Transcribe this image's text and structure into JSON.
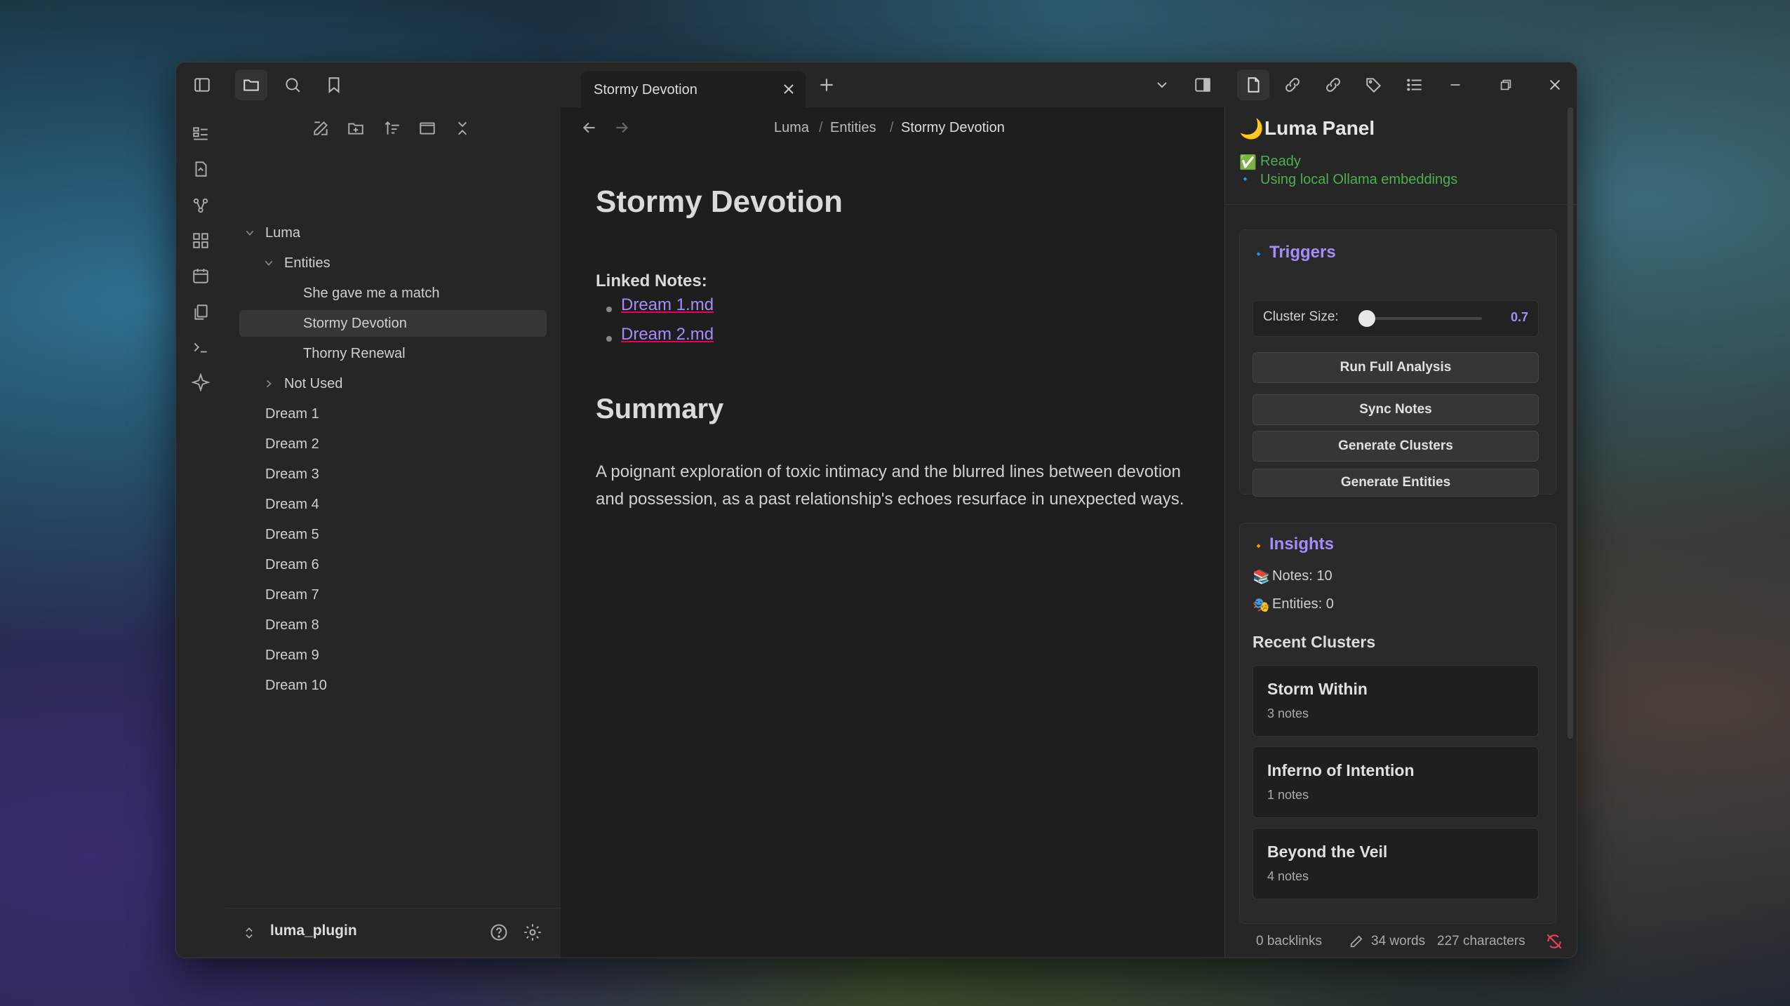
{
  "tabs": [
    {
      "title": "Stormy Devotion"
    }
  ],
  "breadcrumb": [
    "Luma",
    "Entities",
    "Stormy Devotion"
  ],
  "breadcrumb_sep": "/",
  "file_tree": {
    "root": "Luma",
    "entities_folder": "Entities",
    "entities": [
      "She gave me a match",
      "Stormy Devotion",
      "Thorny Renewal"
    ],
    "not_used_folder": "Not Used",
    "dreams": [
      "Dream 1",
      "Dream 2",
      "Dream 3",
      "Dream 4",
      "Dream 5",
      "Dream 6",
      "Dream 7",
      "Dream 8",
      "Dream 9",
      "Dream 10"
    ]
  },
  "vault": {
    "name": "luma_plugin"
  },
  "document": {
    "title": "Stormy Devotion",
    "linked_label": "Linked Notes:",
    "links": [
      "Dream 1.md",
      "Dream 2.md"
    ],
    "summary_heading": "Summary",
    "summary_text": "A poignant exploration of toxic intimacy and the blurred lines between devotion and possession, as a past relationship's echoes resurface in unexpected ways."
  },
  "panel": {
    "title": "Luma Panel",
    "title_icon": "🌙",
    "status_icon": "✅",
    "status_ready": "Ready",
    "status_detail_icon": "🔹",
    "status_detail": "Using local Ollama embeddings",
    "triggers_icon": "🔹",
    "triggers_heading": "Triggers",
    "cluster_size_label": "Cluster Size:",
    "cluster_size_value": "0.7",
    "cluster_size_fraction": 0.0,
    "buttons": [
      "Run Full Analysis",
      "Sync Notes",
      "Generate Clusters",
      "Generate Entities"
    ],
    "insights_icon": "🔸",
    "insights_heading": "Insights",
    "notes_icon": "📚",
    "notes_count": "Notes: 10",
    "entities_icon": "🎭",
    "entities_count": "Entities: 0",
    "recent_heading": "Recent Clusters",
    "clusters": [
      {
        "name": "Storm Within",
        "count": "3 notes"
      },
      {
        "name": "Inferno of Intention",
        "count": "1 notes"
      },
      {
        "name": "Beyond the Veil",
        "count": "4 notes"
      }
    ]
  },
  "statusbar": {
    "backlinks": "0 backlinks",
    "words": "34 words",
    "characters": "227 characters"
  },
  "colors": {
    "accent": "#a78bfa",
    "ready": "#4caf50",
    "background": "#1e1e1e"
  }
}
